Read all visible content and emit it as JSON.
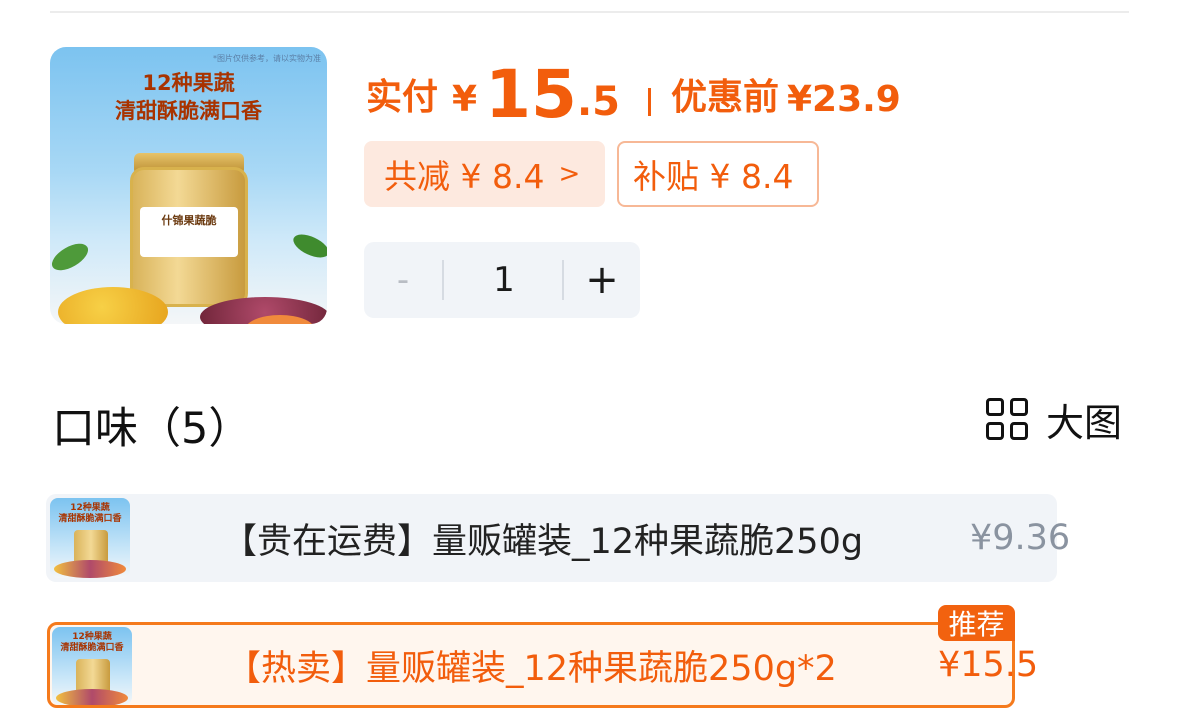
{
  "product_image": {
    "corner_note": "*图片仅供参考，请以实物为准",
    "headline_line1": "12种果蔬",
    "headline_line2": "清甜酥脆满口香",
    "jar_label": "什锦果蔬脆"
  },
  "price": {
    "pay_label": "实付",
    "currency": "¥",
    "pay_integer": "15",
    "pay_decimal": ".5",
    "original_label": "优惠前",
    "original_price": "¥23.9"
  },
  "discounts": {
    "total_label": "共减 ¥ 8.4",
    "subsidy_label": "补贴 ¥ 8.4"
  },
  "quantity": {
    "minus": "-",
    "value": "1",
    "plus": "+"
  },
  "flavor_section": {
    "title": "口味（5）",
    "big_view_label": "大图"
  },
  "options": [
    {
      "thumb_text": "12种果蔬\n清甜酥脆满口香",
      "name": "【贵在运费】量贩罐装_12种果蔬脆250g",
      "price": "¥9.36",
      "selected": false
    },
    {
      "thumb_text": "12种果蔬\n清甜酥脆满口香",
      "name": "【热卖】量贩罐装_12种果蔬脆250g*2",
      "price": "¥15.5",
      "selected": true,
      "badge": "推荐"
    }
  ],
  "colors": {
    "accent": "#f25d0c",
    "chip_bg": "#fde9df",
    "stepper_bg": "#f1f4f8",
    "selected_border": "#f57a1c"
  }
}
